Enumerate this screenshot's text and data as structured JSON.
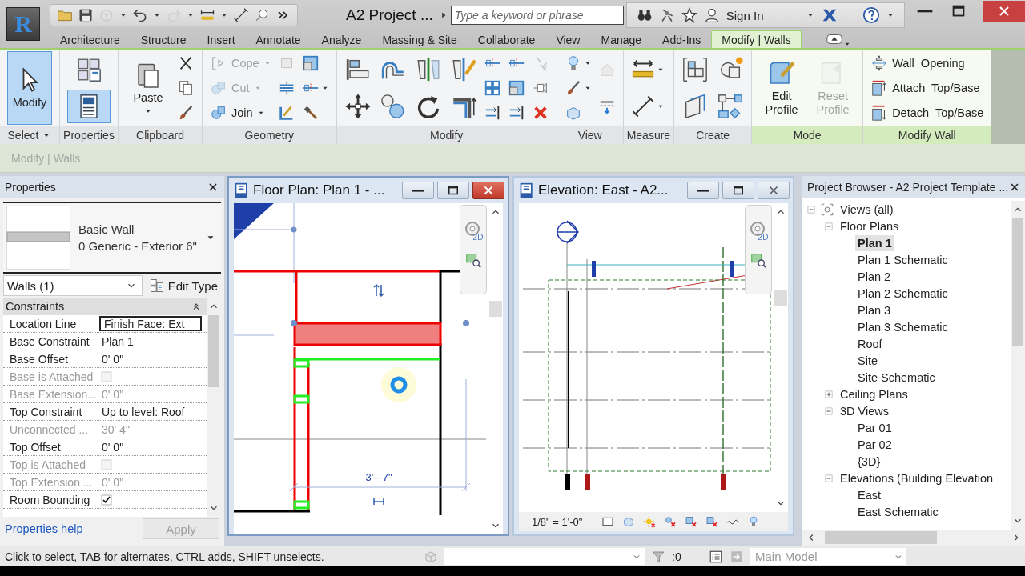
{
  "app": {
    "logo": "R"
  },
  "quick_access": [
    {
      "disabled": false
    },
    {
      "disabled": false
    },
    {
      "disabled": true
    },
    {
      "disabled": false
    },
    {
      "disabled": true
    },
    {
      "disabled": false
    },
    {
      "disabled": false
    },
    {
      "disabled": false
    },
    {
      "disabled": false
    }
  ],
  "title": "A2 Project ...",
  "search": {
    "placeholder": "Type a keyword or phrase"
  },
  "sign_in": "Sign In",
  "tabs": [
    {
      "label": "Architecture",
      "selected": false
    },
    {
      "label": "Structure",
      "selected": false
    },
    {
      "label": "Insert",
      "selected": false
    },
    {
      "label": "Annotate",
      "selected": false
    },
    {
      "label": "Analyze",
      "selected": false
    },
    {
      "label": "Massing & Site",
      "selected": false
    },
    {
      "label": "Collaborate",
      "selected": false
    },
    {
      "label": "View",
      "selected": false
    },
    {
      "label": "Manage",
      "selected": false
    },
    {
      "label": "Add-Ins",
      "selected": false
    },
    {
      "label": "Modify | Walls",
      "selected": true
    }
  ],
  "ribbon": {
    "panels": [
      {
        "title": "Select",
        "menu": true,
        "contextual": false,
        "groups": [
          {
            "kind": "large",
            "tools": [
              {
                "label": "Modify",
                "selected": true
              }
            ]
          }
        ]
      },
      {
        "title": "Properties",
        "menu": false,
        "contextual": false,
        "groups": [
          {
            "kind": "mid",
            "tools": [
              {
                "selected": false
              },
              {
                "selected": true
              }
            ]
          }
        ]
      },
      {
        "title": "Clipboard",
        "menu": false,
        "contextual": false,
        "groups": [
          {
            "kind": "large",
            "tools": [
              {
                "label": "Paste",
                "menu": true,
                "disabled": false
              }
            ]
          },
          {
            "kind": "stack",
            "tools": [
              {
                "disabled": false
              },
              {
                "disabled": false
              },
              {
                "disabled": false
              }
            ]
          }
        ]
      },
      {
        "title": "Geometry",
        "menu": false,
        "contextual": false,
        "groups": [
          {
            "kind": "stack",
            "tools": [
              {
                "label": "Cope",
                "menu": true,
                "disabled": true
              },
              {
                "label": "Cut",
                "menu": true,
                "disabled": true
              },
              {
                "label": "Join",
                "menu": true,
                "disabled": false
              }
            ]
          },
          {
            "kind": "stack",
            "tools": [
              {
                "disabled": true
              },
              {
                "disabled": false
              },
              {
                "disabled": false
              }
            ]
          },
          {
            "kind": "stack",
            "tools": [
              {
                "disabled": false
              },
              {
                "disabled": false,
                "menu": true
              },
              {
                "disabled": false
              }
            ]
          }
        ]
      },
      {
        "title": "Modify",
        "menu": false,
        "contextual": false,
        "groups": [
          {
            "kind": "mid",
            "tools": [
              {
                "disabled": false
              },
              {
                "disabled": false
              },
              {
                "disabled": false
              },
              {
                "disabled": false
              },
              {
                "disabled": false
              },
              {
                "disabled": false
              },
              {
                "disabled": false
              },
              {
                "disabled": false
              }
            ]
          },
          {
            "kind": "stack",
            "tools": [
              {
                "disabled": false
              },
              {
                "disabled": false
              },
              {
                "disabled": false
              }
            ]
          },
          {
            "kind": "stack",
            "tools": [
              {
                "disabled": false
              },
              {
                "disabled": false
              },
              {
                "disabled": false
              }
            ]
          },
          {
            "kind": "stack",
            "tools": [
              {
                "disabled": true
              },
              {
                "disabled": false
              },
              {
                "disabled": false
              }
            ]
          }
        ]
      },
      {
        "title": "View",
        "menu": false,
        "contextual": false,
        "groups": [
          {
            "kind": "stack",
            "tools": [
              {
                "disabled": false,
                "menu": true
              },
              {
                "disabled": false,
                "menu": true
              },
              {
                "disabled": false
              }
            ]
          },
          {
            "kind": "stack",
            "tools": [
              {
                "disabled": true
              },
              {
                "disabled": false
              }
            ]
          }
        ]
      },
      {
        "title": "Measure",
        "menu": false,
        "contextual": false,
        "groups": [
          {
            "kind": "mid",
            "tools": [
              {
                "disabled": false,
                "menu": true
              },
              {
                "disabled": false,
                "menu": true
              }
            ]
          }
        ]
      },
      {
        "title": "Create",
        "menu": false,
        "contextual": false,
        "groups": [
          {
            "kind": "mid",
            "tools": [
              {
                "disabled": false
              },
              {
                "disabled": false
              },
              {
                "disabled": false
              },
              {
                "disabled": false
              }
            ]
          }
        ]
      },
      {
        "title": "Mode",
        "menu": false,
        "contextual": true,
        "groups": [
          {
            "kind": "large",
            "tools": [
              {
                "label": "Edit Profile",
                "disabled": false
              }
            ]
          },
          {
            "kind": "large",
            "tools": [
              {
                "label": "Reset Profile",
                "disabled": true
              }
            ]
          }
        ]
      },
      {
        "title": "Modify Wall",
        "menu": false,
        "contextual": true,
        "groups": [
          {
            "kind": "stack",
            "tools": [
              {
                "label": "Wall  Opening",
                "disabled": false
              },
              {
                "label": "Attach  Top/Base",
                "disabled": false
              },
              {
                "label": "Detach  Top/Base",
                "disabled": false
              }
            ]
          }
        ]
      }
    ]
  },
  "options_bar": "Modify | Walls",
  "properties": {
    "title": "Properties",
    "type_family": "Basic Wall",
    "type_name": "0 Generic - Exterior 6\"",
    "filter": "Walls (1)",
    "edit_type": "Edit Type",
    "group": "Constraints",
    "rows": [
      {
        "name": "Location Line",
        "value": "Finish Face: Ext",
        "kind": "text",
        "disabled": false,
        "selected": true
      },
      {
        "name": "Base Constraint",
        "value": "Plan 1",
        "kind": "text",
        "disabled": false,
        "selected": false
      },
      {
        "name": "Base Offset",
        "value": "0'  0\"",
        "kind": "text",
        "disabled": false,
        "selected": false
      },
      {
        "name": "Base is Attached",
        "kind": "checkbox",
        "checked": false,
        "disabled": true,
        "selected": false
      },
      {
        "name": "Base Extension...",
        "value": "0'  0\"",
        "kind": "text",
        "disabled": true,
        "selected": false
      },
      {
        "name": "Top Constraint",
        "value": "Up to level: Roof",
        "kind": "text",
        "disabled": false,
        "selected": false
      },
      {
        "name": "Unconnected ...",
        "value": "30'  4\"",
        "kind": "text",
        "disabled": true,
        "selected": false
      },
      {
        "name": "Top Offset",
        "value": "0'  0\"",
        "kind": "text",
        "disabled": false,
        "selected": false
      },
      {
        "name": "Top is Attached",
        "kind": "checkbox",
        "checked": false,
        "disabled": true,
        "selected": false
      },
      {
        "name": "Top Extension ...",
        "value": "0'  0\"",
        "kind": "text",
        "disabled": true,
        "selected": false
      },
      {
        "name": "Room Bounding",
        "kind": "checkbox",
        "checked": true,
        "disabled": false,
        "selected": false
      }
    ],
    "help": "Properties help",
    "apply": "Apply"
  },
  "views": [
    {
      "kind": "plan",
      "title": "Floor Plan: Plan 1 - ...",
      "active": true,
      "nav_label": "2D",
      "dimension": "3' - 7\""
    },
    {
      "kind": "elevation",
      "title": "Elevation: East - A2...",
      "active": false,
      "nav_label": "2D",
      "scale": "1/8\" = 1'-0\""
    }
  ],
  "browser": {
    "title": "Project Browser - A2 Project Template ...",
    "tree": [
      {
        "label": "Views (all)",
        "expanded": true,
        "selected": false,
        "children": [
          {
            "label": "Floor Plans",
            "expanded": true,
            "selected": false,
            "children": [
              {
                "label": "Plan 1",
                "selected": true
              },
              {
                "label": "Plan 1 Schematic",
                "selected": false
              },
              {
                "label": "Plan 2",
                "selected": false
              },
              {
                "label": "Plan 2 Schematic",
                "selected": false
              },
              {
                "label": "Plan 3",
                "selected": false
              },
              {
                "label": "Plan 3 Schematic",
                "selected": false
              },
              {
                "label": "Roof",
                "selected": false
              },
              {
                "label": "Site",
                "selected": false
              },
              {
                "label": "Site Schematic",
                "selected": false
              }
            ]
          },
          {
            "label": "Ceiling Plans",
            "expanded": false,
            "selected": false
          },
          {
            "label": "3D Views",
            "expanded": true,
            "selected": false,
            "children": [
              {
                "label": "Par 01",
                "selected": false
              },
              {
                "label": "Par 02",
                "selected": false
              },
              {
                "label": "{3D}",
                "selected": false
              }
            ]
          },
          {
            "label": "Elevations (Building Elevation",
            "expanded": true,
            "selected": false,
            "children": [
              {
                "label": "East",
                "selected": false
              },
              {
                "label": "East Schematic",
                "selected": false
              }
            ]
          }
        ]
      }
    ]
  },
  "status": {
    "hint": "Click to select, TAB for alternates, CTRL adds, SHIFT unselects.",
    "filter_count": ":0",
    "design_option": "Main Model"
  }
}
